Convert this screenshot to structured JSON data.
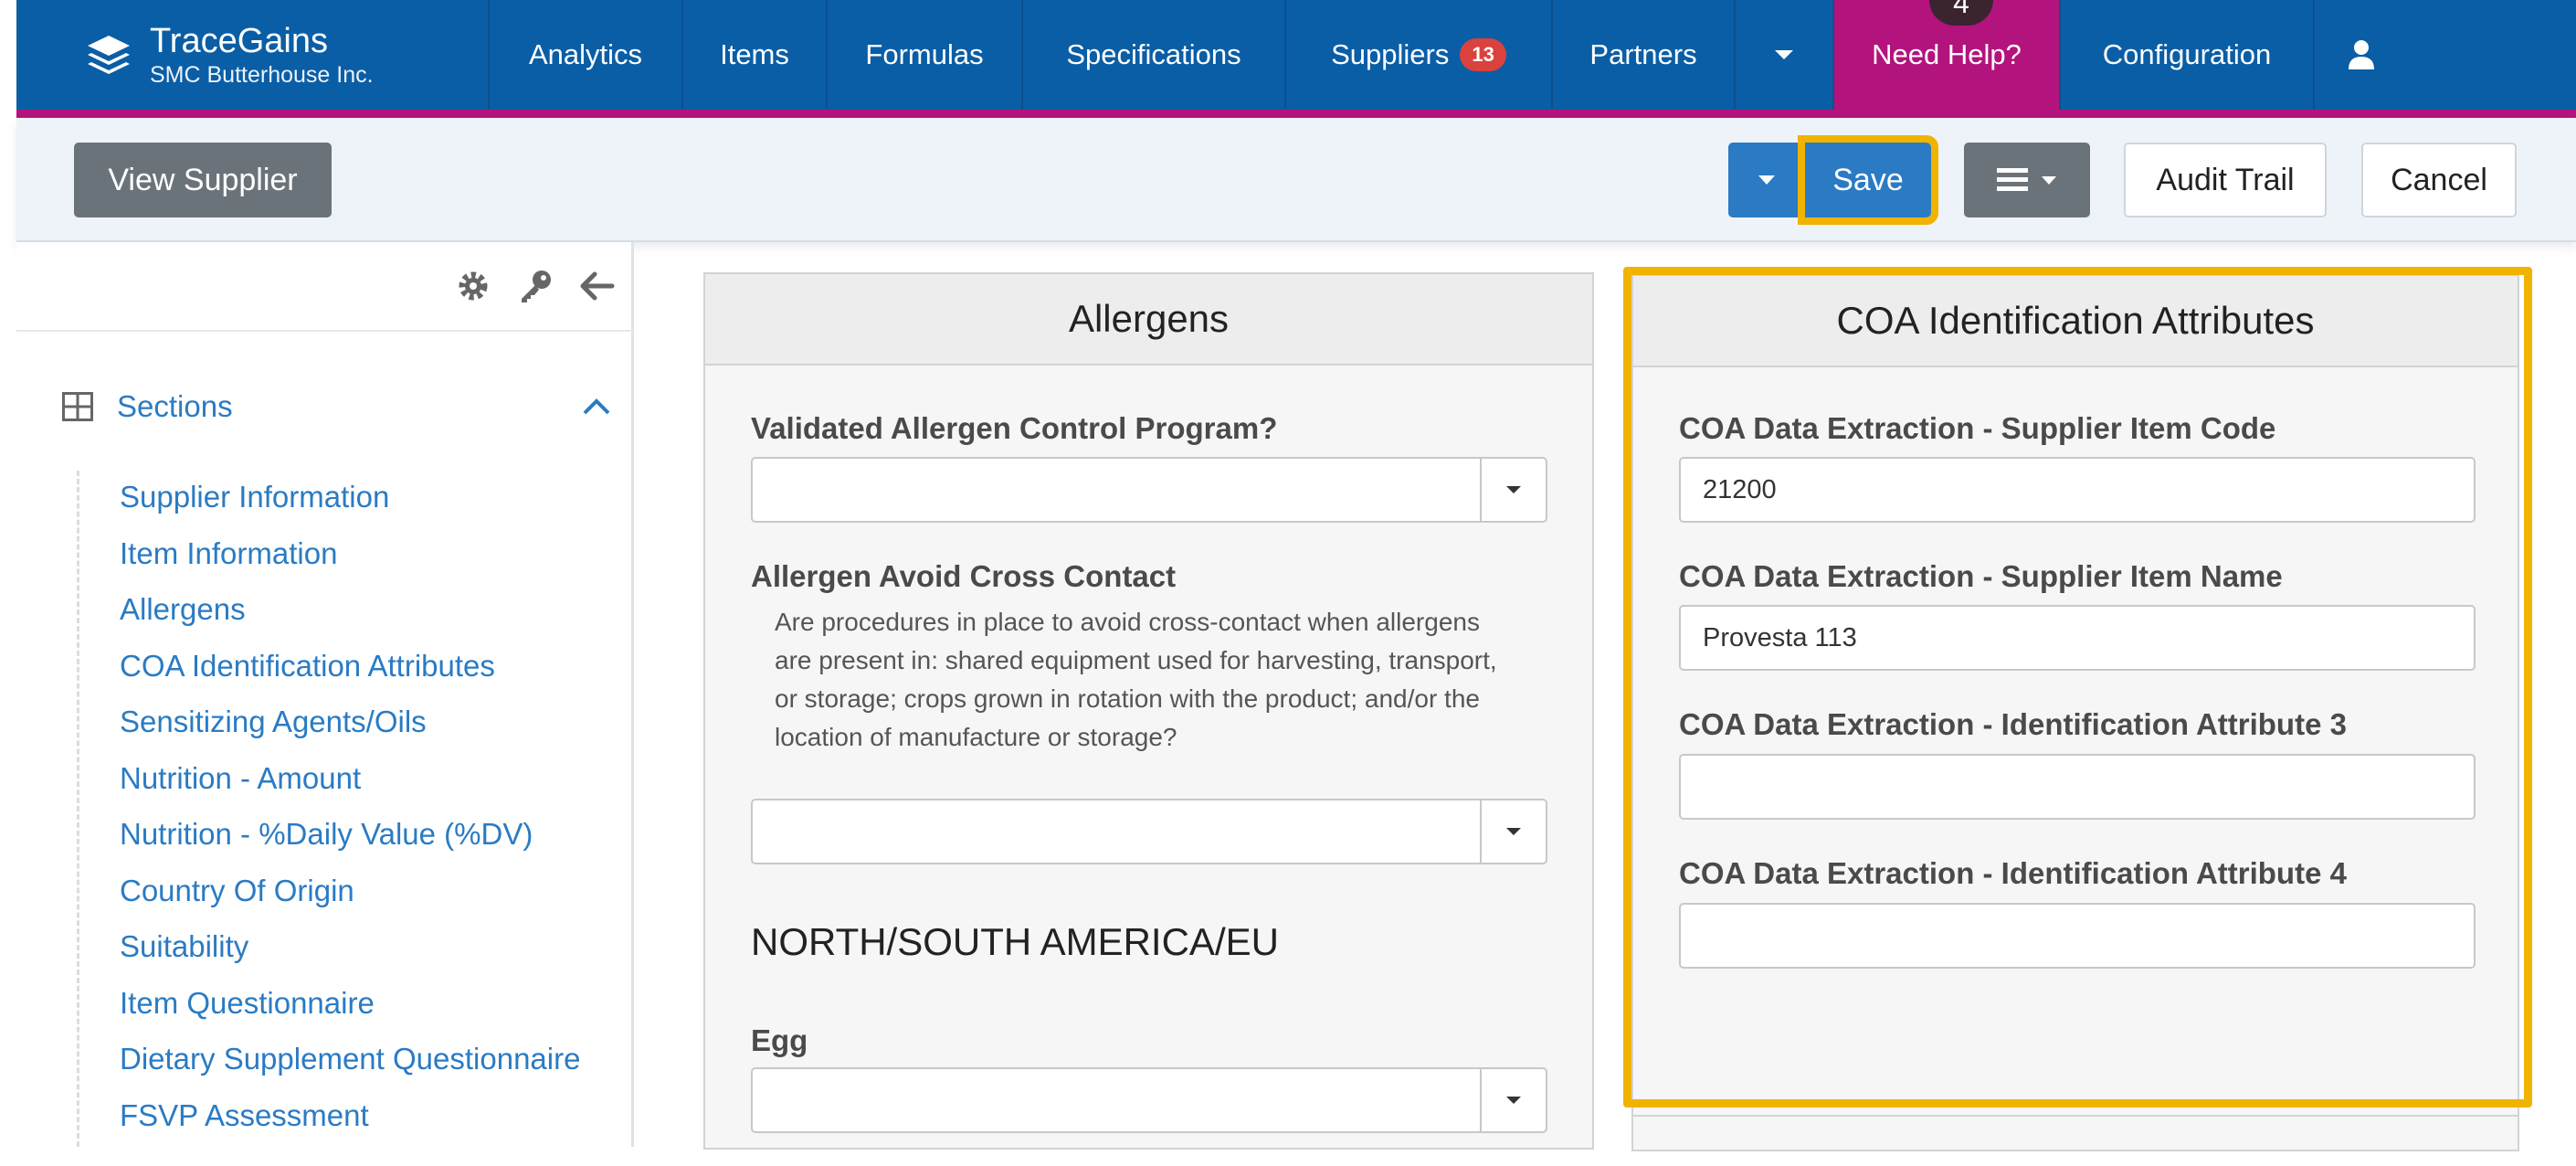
{
  "brand": {
    "name": "TraceGains",
    "company": "SMC Butterhouse Inc."
  },
  "nav": {
    "items": [
      {
        "label": "Analytics"
      },
      {
        "label": "Items"
      },
      {
        "label": "Formulas"
      },
      {
        "label": "Specifications"
      },
      {
        "label": "Suppliers",
        "badge": "13"
      },
      {
        "label": "Partners"
      }
    ],
    "help_label": "Need Help?",
    "help_step": "4",
    "config_label": "Configuration",
    "icons": [
      "chevron-down-icon",
      "user-icon",
      "layers-logo-icon"
    ]
  },
  "toolbar": {
    "view_supplier": "View Supplier",
    "save": "Save",
    "audit_trail": "Audit Trail",
    "cancel": "Cancel"
  },
  "sidebar": {
    "sections_label": "Sections",
    "items": [
      "Supplier Information",
      "Item Information",
      "Allergens",
      "COA Identification Attributes",
      "Sensitizing Agents/Oils",
      "Nutrition - Amount",
      "Nutrition - %Daily Value (%DV)",
      "Country Of Origin",
      "Suitability",
      "Item Questionnaire",
      "Dietary Supplement Questionnaire",
      "FSVP Assessment"
    ]
  },
  "allergens": {
    "title": "Allergens",
    "validated_label": "Validated Allergen Control Program?",
    "cross_label": "Allergen Avoid Cross Contact",
    "cross_desc": "Are procedures in place to avoid cross-contact when allergens are present in: shared equipment used for harvesting, transport, or storage; crops grown in rotation with the product; and/or the location of manufacture or storage?",
    "region": "NORTH/SOUTH AMERICA/EU",
    "egg_label": "Egg"
  },
  "coa": {
    "title": "COA Identification Attributes",
    "item_code_label": "COA Data Extraction - Supplier Item Code",
    "item_code_value": "21200",
    "item_name_label": "COA Data Extraction - Supplier Item Name",
    "item_name_value": "Provesta 113",
    "attr3_label": "COA Data Extraction - Identification Attribute 3",
    "attr3_value": "",
    "attr4_label": "COA Data Extraction - Identification Attribute 4",
    "attr4_value": ""
  },
  "colors": {
    "nav": "#0a5ea6",
    "accent": "#b3137d",
    "highlight": "#f0b400",
    "link": "#2a7bc4"
  }
}
